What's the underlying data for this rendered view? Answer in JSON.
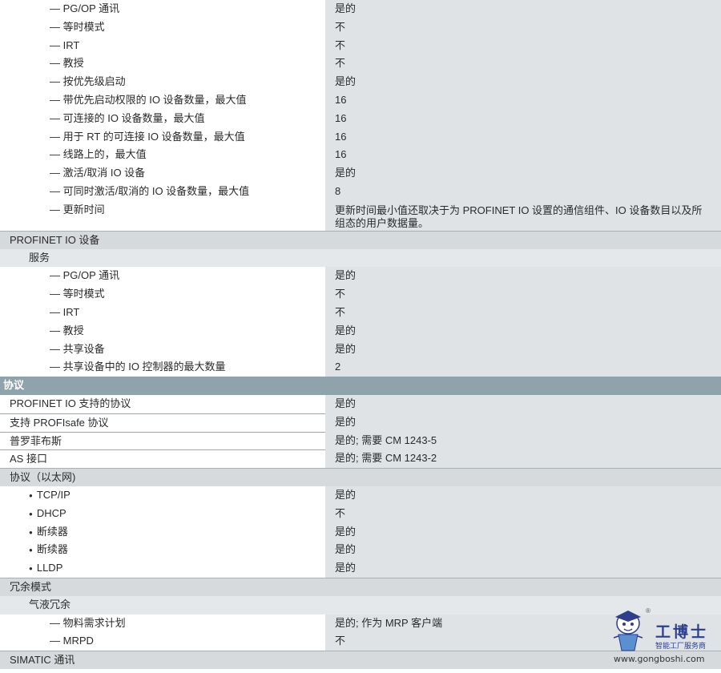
{
  "controller_services": [
    {
      "label": "— PG/OP 通讯",
      "value": "是的"
    },
    {
      "label": "— 等时模式",
      "value": "不"
    },
    {
      "label": "— IRT",
      "value": "不"
    },
    {
      "label": "— 教授",
      "value": "不"
    },
    {
      "label": "— 按优先级启动",
      "value": "是的"
    },
    {
      "label": "— 带优先启动权限的 IO 设备数量，最大值",
      "value": "16"
    },
    {
      "label": "— 可连接的 IO 设备数量，最大值",
      "value": "16"
    },
    {
      "label": "— 用于 RT 的可连接 IO 设备数量，最大值",
      "value": "16"
    },
    {
      "label": "— 线路上的，最大值",
      "value": "16"
    },
    {
      "label": "— 激活/取消 IO 设备",
      "value": "是的"
    },
    {
      "label": "— 可同时激活/取消的 IO 设备数量，最大值",
      "value": "8"
    }
  ],
  "update_time": {
    "label": "— 更新时间",
    "value": "更新时间最小值还取决于为 PROFINET IO 设置的通信组件、IO 设备数目以及所组态的用户数据量。"
  },
  "device_section": {
    "title": "PROFINET IO 设备",
    "services_title": "服务"
  },
  "device_services": [
    {
      "label": "— PG/OP 通讯",
      "value": "是的"
    },
    {
      "label": "— 等时模式",
      "value": "不"
    },
    {
      "label": "— IRT",
      "value": "不"
    },
    {
      "label": "— 教授",
      "value": "是的"
    },
    {
      "label": "— 共享设备",
      "value": "是的"
    },
    {
      "label": "— 共享设备中的 IO 控制器的最大数量",
      "value": "2"
    }
  ],
  "protocols": {
    "title": "协议",
    "rows": [
      {
        "label": "PROFINET IO 支持的协议",
        "value": "是的"
      },
      {
        "label": "支持 PROFIsafe 协议",
        "value": "是的"
      },
      {
        "label": "普罗菲布斯",
        "value": "是的; 需要 CM 1243-5"
      },
      {
        "label": "AS 接口",
        "value": "是的; 需要 CM 1243-2"
      }
    ]
  },
  "ethernet": {
    "title": "协议（以太网)",
    "rows": [
      {
        "label": "TCP/IP",
        "value": "是的"
      },
      {
        "label": "DHCP",
        "value": "不"
      },
      {
        "label": "断续器",
        "value": "是的"
      },
      {
        "label": "断续器",
        "value": "是的"
      },
      {
        "label": "LLDP",
        "value": "是的"
      }
    ]
  },
  "redundancy": {
    "title": "冗余模式",
    "sub_title": "气液冗余",
    "rows": [
      {
        "label": "— 物料需求计划",
        "value": "是的; 作为 MRP 客户端"
      },
      {
        "label": "— MRPD",
        "value": "不"
      }
    ]
  },
  "simatic": {
    "title": "SIMATIC 通讯"
  },
  "watermark": {
    "title": "工博士",
    "subtitle": "智能工厂服务商",
    "url": "www.gongboshi.com",
    "reg": "®"
  }
}
